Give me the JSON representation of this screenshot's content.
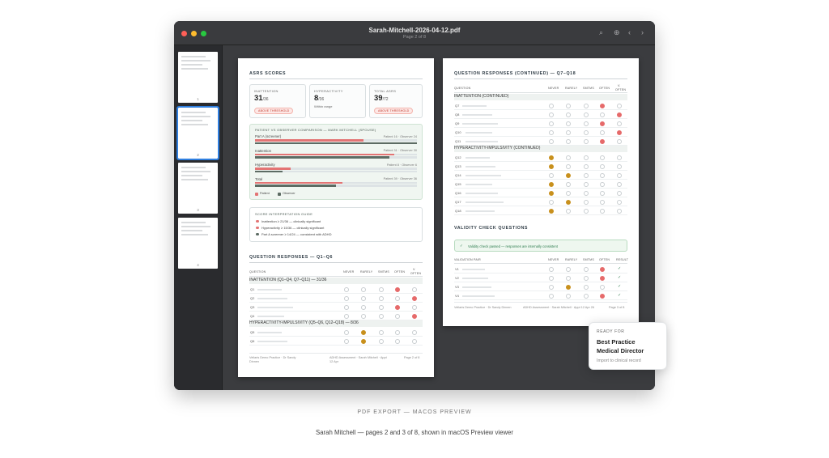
{
  "window": {
    "title": "Sarah-Mitchell-2026-04-12.pdf",
    "subtitle": "Page 2 of 8"
  },
  "toolbar": {
    "search_icon": "⌕",
    "zoom_icon": "⊕",
    "prev_icon": "‹",
    "next_icon": "›"
  },
  "thumbnails": [
    {
      "num": "1"
    },
    {
      "num": "2"
    },
    {
      "num": "3"
    },
    {
      "num": "4"
    }
  ],
  "page2": {
    "title": "ASRS SCORES",
    "scores": [
      {
        "label": "INATTENTION",
        "value": "31",
        "max": "/36",
        "note": "",
        "pill": "ABOVE THRESHOLD"
      },
      {
        "label": "HYPERACTIVITY",
        "value": "8",
        "max": "/36",
        "note": "Within range",
        "pill": ""
      },
      {
        "label": "TOTAL ASRS",
        "value": "39",
        "max": "/72",
        "note": "",
        "pill": "ABOVE THRESHOLD"
      }
    ],
    "comparison": {
      "title": "PATIENT VS OBSERVER COMPARISON — MARK MITCHELL (SPOUSE)",
      "rows": [
        {
          "label": "Part A (screener)",
          "vals": "Patient 16 · Observer 24",
          "patient": 0.67,
          "observer": 1.0
        },
        {
          "label": "Inattention",
          "vals": "Patient 31 · Observer 30",
          "patient": 0.86,
          "observer": 0.83
        },
        {
          "label": "Hyperactivity",
          "vals": "Patient 8 · Observer 6",
          "patient": 0.22,
          "observer": 0.17
        },
        {
          "label": "Total",
          "vals": "Patient 39 · Observer 36",
          "patient": 0.54,
          "observer": 0.5
        }
      ],
      "legend_patient": "Patient",
      "legend_observer": "Observer"
    },
    "guide": {
      "title": "SCORE INTERPRETATION GUIDE",
      "items": [
        {
          "text": "Inattention ≥ 21/36 — clinically significant",
          "color": "#e37474"
        },
        {
          "text": "Hyperactivity ≥ 15/36 — clinically significant",
          "color": "#e37474"
        },
        {
          "text": "Part A screener ≥ 14/24 — consistent with ADHD",
          "color": "#5c6b63"
        }
      ]
    },
    "responses_title": "QUESTION RESPONSES — Q1–Q6",
    "cols": {
      "question": "QUESTION",
      "never": "NEVER",
      "rarely": "RARELY",
      "smtms": "SMTMS",
      "often": "OFTEN",
      "vo1": "V.",
      "vo2": "OFTEN"
    },
    "sec1": "INATTENTION (Q1–Q4, Q7–Q11) — 31/36",
    "sec2": "HYPERACTIVITY-IMPULSIVITY (Q5–Q6, Q12–Q18) — 8/36",
    "q": [
      {
        "id": "Q1",
        "pick": 3,
        "color": "red"
      },
      {
        "id": "Q2",
        "pick": 4,
        "color": "red"
      },
      {
        "id": "Q3",
        "pick": 3,
        "color": "red"
      },
      {
        "id": "Q4",
        "pick": 4,
        "color": "red"
      },
      {
        "id": "Q5",
        "pick": 1,
        "color": "gold"
      },
      {
        "id": "Q6",
        "pick": 1,
        "color": "gold"
      }
    ],
    "footer": [
      "Vellaris Demo Practice · Dr Sandy Dinnen",
      "ADHD Assessment · Sarah Mitchell · Appt 12 Apr",
      "Page 2 of 8"
    ]
  },
  "page3": {
    "title": "QUESTION RESPONSES (CONTINUED) — Q7–Q18",
    "sec1": "INATTENTION (CONTINUED)",
    "sec2": "HYPERACTIVITY-IMPULSIVITY (CONTINUED)",
    "q1": [
      {
        "id": "Q7",
        "pick": 3,
        "color": "red"
      },
      {
        "id": "Q8",
        "pick": 4,
        "color": "red"
      },
      {
        "id": "Q9",
        "pick": 3,
        "color": "red"
      },
      {
        "id": "Q10",
        "pick": 4,
        "color": "red"
      },
      {
        "id": "Q11",
        "pick": 3,
        "color": "red"
      }
    ],
    "q2": [
      {
        "id": "Q12",
        "pick": 0,
        "color": "gold"
      },
      {
        "id": "Q13",
        "pick": 0,
        "color": "gold"
      },
      {
        "id": "Q14",
        "pick": 1,
        "color": "gold"
      },
      {
        "id": "Q15",
        "pick": 0,
        "color": "gold"
      },
      {
        "id": "Q16",
        "pick": 0,
        "color": "gold"
      },
      {
        "id": "Q17",
        "pick": 1,
        "color": "gold"
      },
      {
        "id": "Q18",
        "pick": 0,
        "color": "gold"
      }
    ],
    "validity_title": "VALIDITY CHECK QUESTIONS",
    "validity_msg": "Validity check passed — responses are internally consistent",
    "vcols": {
      "pair": "VALIDATION PAIR",
      "never": "NEVER",
      "rarely": "RARELY",
      "smtms": "SMTMS",
      "often": "OFTEN",
      "result": "RESULT"
    },
    "v": [
      {
        "id": "V1",
        "pick": 3,
        "color": "red"
      },
      {
        "id": "V2",
        "pick": 3,
        "color": "red"
      },
      {
        "id": "V3",
        "pick": 1,
        "color": "gold"
      },
      {
        "id": "V4",
        "pick": 3,
        "color": "red"
      }
    ],
    "check": "✓",
    "footer": [
      "Vellaris Demo Practice · Dr Sandy Dinnen",
      "ADHD Assessment · Sarah Mitchell · Appt 12 Apr 26",
      "Page 3 of 8"
    ]
  },
  "ready": {
    "label": "READY FOR",
    "line1": "Best Practice",
    "line2": "Medical Director",
    "sub": "Import to clinical record"
  },
  "caption": {
    "tag": "PDF EXPORT — MACOS PREVIEW",
    "text": "Sarah Mitchell — pages 2 and 3 of 8, shown in macOS Preview viewer"
  }
}
